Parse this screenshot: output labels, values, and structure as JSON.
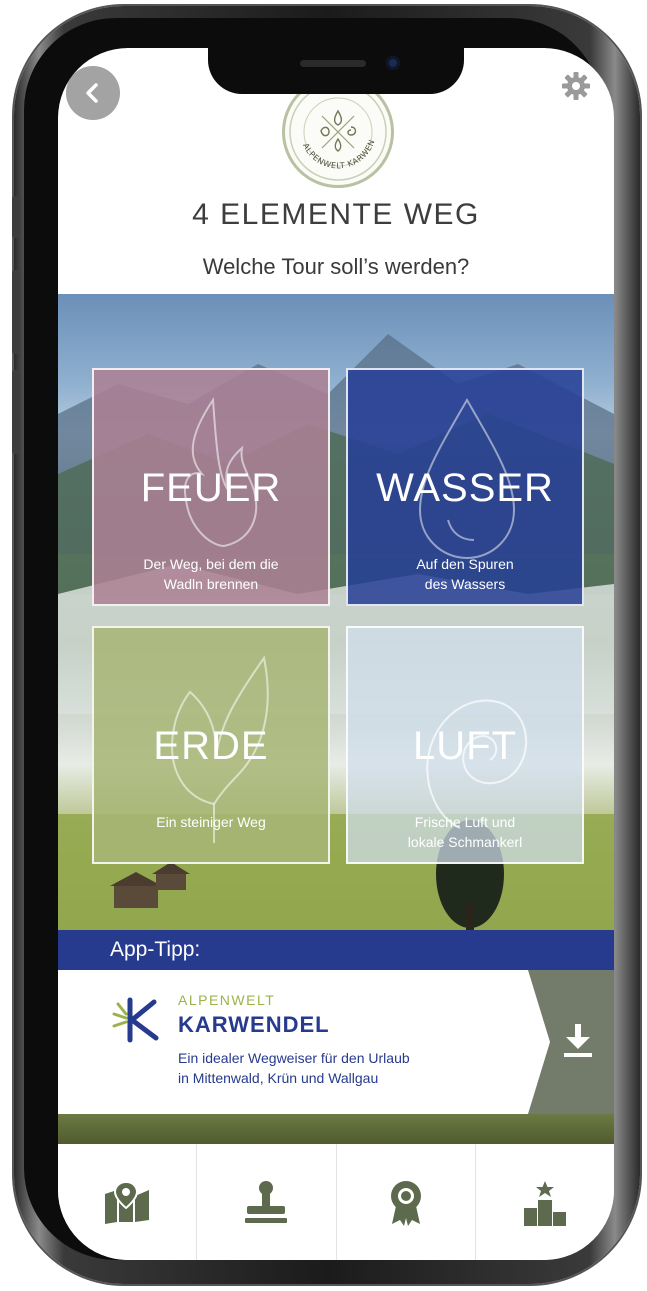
{
  "header": {
    "title": "4 ELEMENTE WEG",
    "subtitle": "Welche Tour soll’s werden?",
    "logo_text": "ALPENWELT KARWENDEL"
  },
  "tiles": [
    {
      "title": "FEUER",
      "description_line1": "Der Weg, bei dem die",
      "description_line2": "Wadln brennen",
      "color": "#ac8094",
      "icon": "flame-icon"
    },
    {
      "title": "WASSER",
      "description_line1": "Auf den Spuren",
      "description_line2": "des Wassers",
      "color": "#263e96",
      "icon": "water-drop-icon"
    },
    {
      "title": "ERDE",
      "description_line1": "Ein steiniger Weg",
      "description_line2": "",
      "color": "#a8b676",
      "icon": "leaf-icon"
    },
    {
      "title": "LUFT",
      "description_line1": "Frische Luft und",
      "description_line2": "lokale Schmankerl",
      "color": "#d0deec",
      "icon": "spiral-icon"
    }
  ],
  "app_tip": {
    "label": "App-Tipp:",
    "brand_small": "ALPENWELT",
    "brand_big": "KARWENDEL",
    "description_line1": "Ein idealer Wegweiser für den Urlaub",
    "description_line2": "in Mittenwald, Krün und Wallgau",
    "accent_color": "#263a8e"
  },
  "bottom_nav": [
    {
      "icon": "map-pin-icon"
    },
    {
      "icon": "stamp-icon"
    },
    {
      "icon": "award-ribbon-icon"
    },
    {
      "icon": "ranking-podium-icon"
    }
  ]
}
